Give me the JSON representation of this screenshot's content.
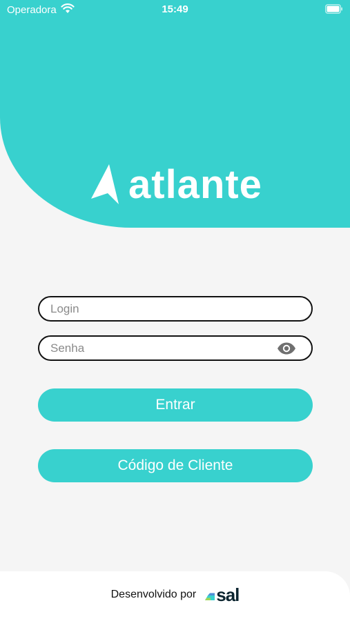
{
  "status_bar": {
    "carrier": "Operadora",
    "time": "15:49"
  },
  "brand": {
    "name": "atlante",
    "color": "#38d1ce"
  },
  "form": {
    "login_placeholder": "Login",
    "password_placeholder": "Senha"
  },
  "buttons": {
    "enter_label": "Entrar",
    "client_code_label": "Código de Cliente"
  },
  "footer": {
    "developed_by": "Desenvolvido por",
    "company": "sal"
  },
  "icons": {
    "status": [
      "wifi-icon",
      "battery-icon"
    ],
    "brand": "arrow-logo-icon",
    "password": "eye-icon",
    "footer": "sal-logo-icon"
  }
}
